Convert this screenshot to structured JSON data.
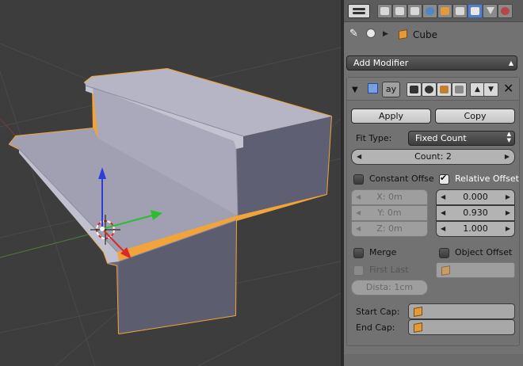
{
  "breadcrumb": {
    "object_name": "Cube"
  },
  "add_modifier": {
    "label": "Add Modifier"
  },
  "modifier": {
    "name_field": "ay",
    "apply_label": "Apply",
    "copy_label": "Copy",
    "fit_type_label": "Fit Type:",
    "fit_type_value": "Fixed Count",
    "count_label": "Count: 2",
    "constant_offset_label": "Constant Offse",
    "relative_offset_label": "Relative Offset",
    "constant_x": "X: 0m",
    "constant_y": "Y: 0m",
    "constant_z": "Z: 0m",
    "relative_x": "0.000",
    "relative_y": "0.930",
    "relative_z": "1.000",
    "merge_label": "Merge",
    "object_offset_label": "Object Offset",
    "first_last_label": "First Last",
    "distance_label": "Dista: 1cm",
    "start_cap_label": "Start Cap:",
    "end_cap_label": "End Cap:"
  },
  "state": {
    "constant_offset_checked": false,
    "relative_offset_checked": true,
    "merge_checked": false,
    "object_offset_checked": false,
    "first_last_checked": false,
    "active_tab": "modifiers-tab"
  },
  "colors": {
    "viewport_bg": "#3d3d3d",
    "panel_bg": "#727272",
    "selection_outline": "#f2a43a",
    "active_tab": "#5680c2"
  }
}
